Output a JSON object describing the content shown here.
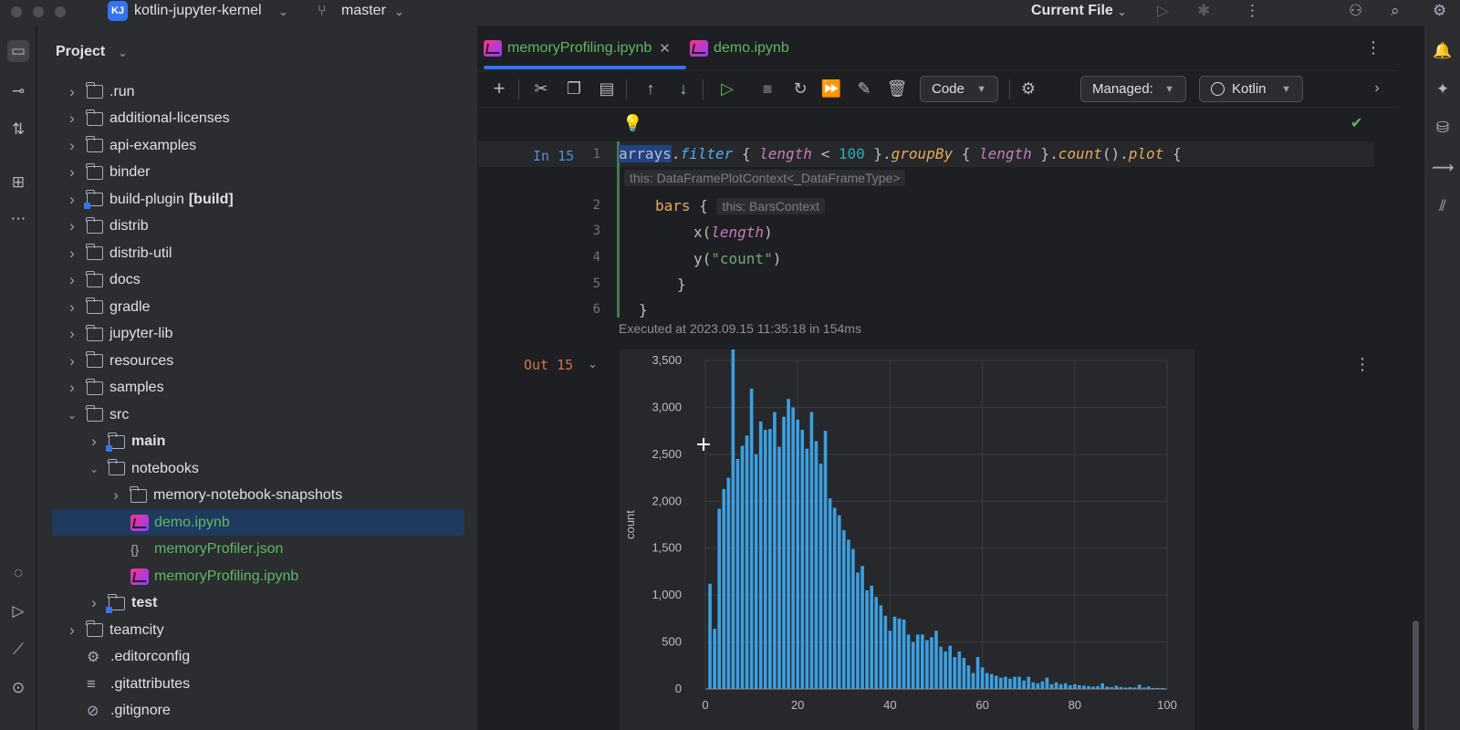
{
  "titlebar": {
    "project_badge": "KJ",
    "project_name": "kotlin-jupyter-kernel",
    "branch": "master",
    "run_config": "Current File"
  },
  "project_panel": {
    "title": "Project",
    "items": [
      {
        "label": ".run",
        "indent": 0,
        "expanded": false,
        "type": "folder"
      },
      {
        "label": "additional-licenses",
        "indent": 0,
        "expanded": false,
        "type": "folder"
      },
      {
        "label": "api-examples",
        "indent": 0,
        "expanded": false,
        "type": "folder"
      },
      {
        "label": "binder",
        "indent": 0,
        "expanded": false,
        "type": "folder"
      },
      {
        "label": "build-plugin",
        "suffix": "[build]",
        "indent": 0,
        "expanded": false,
        "type": "module"
      },
      {
        "label": "distrib",
        "indent": 0,
        "expanded": false,
        "type": "folder"
      },
      {
        "label": "distrib-util",
        "indent": 0,
        "expanded": false,
        "type": "folder"
      },
      {
        "label": "docs",
        "indent": 0,
        "expanded": false,
        "type": "folder"
      },
      {
        "label": "gradle",
        "indent": 0,
        "expanded": false,
        "type": "folder"
      },
      {
        "label": "jupyter-lib",
        "indent": 0,
        "expanded": false,
        "type": "folder"
      },
      {
        "label": "resources",
        "indent": 0,
        "expanded": false,
        "type": "folder"
      },
      {
        "label": "samples",
        "indent": 0,
        "expanded": false,
        "type": "folder"
      },
      {
        "label": "src",
        "indent": 0,
        "expanded": true,
        "type": "folder"
      },
      {
        "label": "main",
        "indent": 1,
        "expanded": false,
        "type": "module-bold"
      },
      {
        "label": "notebooks",
        "indent": 1,
        "expanded": true,
        "type": "folder"
      },
      {
        "label": "memory-notebook-snapshots",
        "indent": 2,
        "expanded": false,
        "type": "folder"
      },
      {
        "label": "demo.ipynb",
        "indent": 2,
        "type": "notebook",
        "selected": true
      },
      {
        "label": "memoryProfiler.json",
        "indent": 2,
        "type": "json"
      },
      {
        "label": "memoryProfiling.ipynb",
        "indent": 2,
        "type": "notebook"
      },
      {
        "label": "test",
        "indent": 1,
        "expanded": false,
        "type": "module-bold"
      },
      {
        "label": "teamcity",
        "indent": 0,
        "expanded": false,
        "type": "folder"
      },
      {
        "label": ".editorconfig",
        "indent": 0,
        "type": "config"
      },
      {
        "label": ".gitattributes",
        "indent": 0,
        "type": "text"
      },
      {
        "label": ".gitignore",
        "indent": 0,
        "type": "ignore"
      }
    ]
  },
  "tabs": [
    {
      "label": "memoryProfiling.ipynb",
      "active": true
    },
    {
      "label": "demo.ipynb",
      "active": false
    }
  ],
  "toolbar": {
    "cell_type": "Code",
    "managed": "Managed:",
    "kernel": "Kotlin"
  },
  "cell": {
    "in_label": "In 15",
    "out_label": "Out 15",
    "executed": "Executed at 2023.09.15 11:35:18 in 154ms",
    "hint_plot": "this: DataFramePlotContext<_DataFrameType>",
    "hint_bars": "this: BarsContext",
    "line_numbers": [
      "1",
      "2",
      "3",
      "4",
      "5",
      "6"
    ],
    "code": {
      "l1_a": "arrays",
      "l1_b": ".",
      "l1_c": "filter",
      "l1_d": " { ",
      "l1_e": "length",
      "l1_f": " < ",
      "l1_g": "100",
      "l1_h": " }.",
      "l1_i": "groupBy",
      "l1_j": " { ",
      "l1_k": "length",
      "l1_l": " }.",
      "l1_m": "count",
      "l1_n": "().",
      "l1_o": "plot",
      "l1_p": " {",
      "l2_a": "bars",
      "l2_b": " {",
      "l3_a": "x(",
      "l3_b": "length",
      "l3_c": ")",
      "l4_a": "y(",
      "l4_b": "\"count\"",
      "l4_c": ")",
      "l5": "}",
      "l6": "}"
    }
  },
  "chart_data": {
    "type": "bar",
    "xlabel": "",
    "ylabel": "count",
    "xlim": [
      0,
      100
    ],
    "ylim": [
      0,
      3500
    ],
    "xticks": [
      "0",
      "20",
      "40",
      "60",
      "80",
      "100"
    ],
    "yticks": [
      "0",
      "500",
      "1,000",
      "1,500",
      "2,000",
      "2,500",
      "3,000",
      "3,500"
    ],
    "color": "#3d9fe0",
    "x": [
      1,
      2,
      3,
      4,
      5,
      6,
      7,
      8,
      9,
      10,
      11,
      12,
      13,
      14,
      15,
      16,
      17,
      18,
      19,
      20,
      21,
      22,
      23,
      24,
      25,
      26,
      27,
      28,
      29,
      30,
      31,
      32,
      33,
      34,
      35,
      36,
      37,
      38,
      39,
      40,
      41,
      42,
      43,
      44,
      45,
      46,
      47,
      48,
      49,
      50,
      51,
      52,
      53,
      54,
      55,
      56,
      57,
      58,
      59,
      60,
      61,
      62,
      63,
      64,
      65,
      66,
      67,
      68,
      69,
      70,
      71,
      72,
      73,
      74,
      75,
      76,
      77,
      78,
      79,
      80,
      81,
      82,
      83,
      84,
      85,
      86,
      87,
      88,
      89,
      90,
      91,
      92,
      93,
      94,
      95,
      96,
      97,
      98,
      99
    ],
    "values": [
      1120,
      640,
      1920,
      2130,
      2250,
      3620,
      2450,
      2590,
      2700,
      3200,
      2500,
      2850,
      2760,
      2770,
      2950,
      2580,
      2900,
      3090,
      3000,
      2870,
      2760,
      2560,
      2950,
      2640,
      2400,
      2750,
      2030,
      1930,
      1850,
      1690,
      1590,
      1490,
      1240,
      1310,
      1050,
      1100,
      980,
      890,
      780,
      620,
      770,
      750,
      740,
      580,
      500,
      580,
      580,
      520,
      550,
      620,
      450,
      400,
      460,
      340,
      400,
      330,
      250,
      170,
      340,
      230,
      170,
      160,
      140,
      120,
      130,
      110,
      130,
      130,
      90,
      130,
      70,
      60,
      80,
      120,
      50,
      70,
      50,
      60,
      40,
      50,
      40,
      35,
      30,
      25,
      30,
      60,
      25,
      20,
      35,
      20,
      15,
      20,
      15,
      45,
      15,
      25,
      10,
      10,
      10
    ]
  }
}
